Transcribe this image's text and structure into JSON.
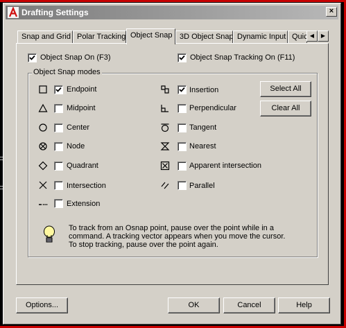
{
  "window": {
    "title": "Drafting Settings",
    "close_glyph": "×",
    "app_icon": "autocad-a-icon"
  },
  "tabs": [
    {
      "label": "Snap and Grid",
      "active": false
    },
    {
      "label": "Polar Tracking",
      "active": false
    },
    {
      "label": "Object Snap",
      "active": true
    },
    {
      "label": "3D Object Snap",
      "active": false
    },
    {
      "label": "Dynamic Input",
      "active": false
    },
    {
      "label": "Quic",
      "active": false
    }
  ],
  "tab_scroll": {
    "left_glyph": "◀",
    "right_glyph": "▶"
  },
  "options": {
    "object_snap_on": {
      "label": "Object Snap On (F3)",
      "checked": true
    },
    "object_snap_tracking_on": {
      "label": "Object Snap Tracking On (F11)",
      "checked": true
    }
  },
  "snap_modes": {
    "legend": "Object Snap modes",
    "left": [
      {
        "label": "Endpoint",
        "checked": true,
        "icon": "endpoint-square-icon"
      },
      {
        "label": "Midpoint",
        "checked": false,
        "icon": "midpoint-triangle-icon"
      },
      {
        "label": "Center",
        "checked": false,
        "icon": "center-circle-icon"
      },
      {
        "label": "Node",
        "checked": false,
        "icon": "node-icon"
      },
      {
        "label": "Quadrant",
        "checked": false,
        "icon": "quadrant-diamond-icon"
      },
      {
        "label": "Intersection",
        "checked": false,
        "icon": "intersection-x-icon"
      },
      {
        "label": "Extension",
        "checked": false,
        "icon": "extension-icon"
      }
    ],
    "right": [
      {
        "label": "Insertion",
        "checked": true,
        "icon": "insertion-icon"
      },
      {
        "label": "Perpendicular",
        "checked": false,
        "icon": "perpendicular-icon"
      },
      {
        "label": "Tangent",
        "checked": false,
        "icon": "tangent-icon"
      },
      {
        "label": "Nearest",
        "checked": false,
        "icon": "nearest-hourglass-icon"
      },
      {
        "label": "Apparent intersection",
        "checked": false,
        "icon": "apparent-intersection-icon"
      },
      {
        "label": "Parallel",
        "checked": false,
        "icon": "parallel-icon"
      }
    ],
    "select_all_label": "Select All",
    "clear_all_label": "Clear All"
  },
  "tip": {
    "icon": "lightbulb-icon",
    "lines": [
      "To track from an Osnap point, pause over the point while in a",
      "command.  A tracking vector appears when you move the cursor.",
      "To stop tracking, pause over the point again."
    ]
  },
  "footer": {
    "options_label": "Options...",
    "ok_label": "OK",
    "cancel_label": "Cancel",
    "help_label": "Help"
  },
  "colors": {
    "dialog_face": "#d4d0c8",
    "title_gradient_start": "#7a7a7a",
    "title_gradient_end": "#b8b8b8",
    "frame_red": "#c80000"
  }
}
